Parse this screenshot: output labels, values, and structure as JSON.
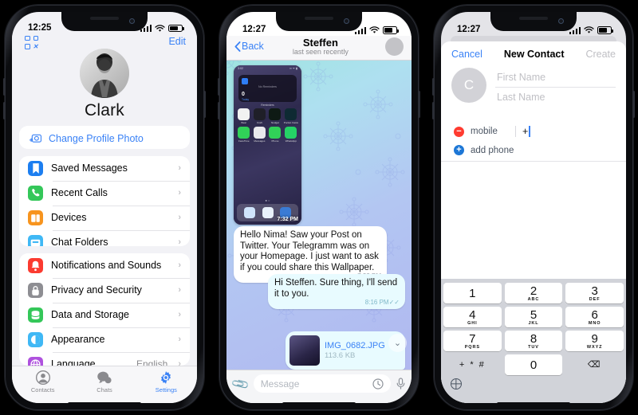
{
  "background_color": "#000000",
  "phone1": {
    "name": "telegram-settings-profile",
    "status_bar": {
      "time": "12:25",
      "icons": [
        "signal-icon",
        "wifi-icon",
        "battery-icon"
      ]
    },
    "header": {
      "qr_icon": "qr-code-icon",
      "edit_label": "Edit"
    },
    "profile": {
      "name": "Clark",
      "avatar": "user-photo"
    },
    "change_photo": {
      "label": "Change Profile Photo",
      "icon": "camera-plus-icon"
    },
    "group1": [
      {
        "label": "Saved Messages",
        "icon": "bookmark-icon",
        "color": "#1c7ef0"
      },
      {
        "label": "Recent Calls",
        "icon": "phone-icon",
        "color": "#34c759"
      },
      {
        "label": "Devices",
        "icon": "devices-icon",
        "color": "#f7941e"
      },
      {
        "label": "Chat Folders",
        "icon": "folder-icon",
        "color": "#3fb8f5"
      }
    ],
    "group2": [
      {
        "label": "Notifications and Sounds",
        "icon": "bell-icon",
        "color": "#fb3b30",
        "value": ""
      },
      {
        "label": "Privacy and Security",
        "icon": "lock-icon",
        "color": "#8e8e93",
        "value": ""
      },
      {
        "label": "Data and Storage",
        "icon": "data-icon",
        "color": "#34c759",
        "value": ""
      },
      {
        "label": "Appearance",
        "icon": "contrast-icon",
        "color": "#3fb8f5",
        "value": ""
      },
      {
        "label": "Language",
        "icon": "globe-icon",
        "color": "#af52de",
        "value": "English"
      }
    ],
    "tabs": [
      {
        "label": "Contacts",
        "icon": "contacts-icon",
        "active": false
      },
      {
        "label": "Chats",
        "icon": "chats-icon",
        "active": false
      },
      {
        "label": "Settings",
        "icon": "gear-icon",
        "active": true
      }
    ],
    "accent_color": "#3a82f6"
  },
  "phone2": {
    "name": "telegram-chat-steffen",
    "status_bar": {
      "time": "12:27"
    },
    "header": {
      "back_label": "Back",
      "title": "Steffen",
      "subtitle": "last seen recently"
    },
    "photo_message": {
      "timestamp": "7:32 PM",
      "screenshot": {
        "status_time": "3:02",
        "widget": {
          "title": "No Reminders",
          "count": "0",
          "day": "Today",
          "caption": "Reminders"
        },
        "apps_row1": [
          {
            "name": "Bear",
            "color": "#f2f2f2"
          },
          {
            "name": "Craft",
            "color": "#1f1f28"
          },
          {
            "name": "Nudget",
            "color": "#0e1a14"
          },
          {
            "name": "Pocket Casts",
            "color": "#0e2a33"
          }
        ],
        "apps_row2": [
          {
            "name": "FaceTime",
            "color": "#31d158"
          },
          {
            "name": "Messages",
            "color": "#e9e9ee"
          },
          {
            "name": "Phone",
            "color": "#31d158"
          },
          {
            "name": "WhatsApp",
            "color": "#25d366"
          }
        ],
        "page_dots": "● ○"
      }
    },
    "messages": [
      {
        "side": "in",
        "text": "Hello Nima! Saw your Post on Twitter. Your Telegramm was on your Homepage. I just want to ask if you could share this Wallpaper.",
        "time": "7:32 PM",
        "read": false
      },
      {
        "side": "out",
        "text": "Hi Steffen. Sure thing, I'll send it to you.",
        "time": "8:16 PM",
        "read": true
      }
    ],
    "file_message": {
      "filename": "IMG_0682.JPG",
      "filesize": "113.6 KB"
    },
    "scroll_button": "chevron-down-icon",
    "composer": {
      "attach_icon": "paperclip-icon",
      "placeholder": "Message",
      "timer_icon": "schedule-icon",
      "mic_icon": "microphone-icon"
    }
  },
  "phone3": {
    "name": "new-contact-sheet",
    "status_bar": {
      "time": "12:27"
    },
    "header": {
      "cancel": "Cancel",
      "title": "New Contact",
      "create": "Create"
    },
    "avatar_initial": "C",
    "fields": [
      {
        "name": "first-name",
        "placeholder": "First Name",
        "value": ""
      },
      {
        "name": "last-name",
        "placeholder": "Last Name",
        "value": ""
      }
    ],
    "phone_row": {
      "remove_icon": "minus-circle-icon",
      "label": "mobile",
      "value": "+"
    },
    "add_phone": {
      "icon": "plus-circle-icon",
      "label": "add phone"
    },
    "keypad": {
      "keys": [
        {
          "num": "1",
          "letters": ""
        },
        {
          "num": "2",
          "letters": "ABC"
        },
        {
          "num": "3",
          "letters": "DEF"
        },
        {
          "num": "4",
          "letters": "GHI"
        },
        {
          "num": "5",
          "letters": "JKL"
        },
        {
          "num": "6",
          "letters": "MNO"
        },
        {
          "num": "7",
          "letters": "PQRS"
        },
        {
          "num": "8",
          "letters": "TUV"
        },
        {
          "num": "9",
          "letters": "WXYZ"
        },
        {
          "num": "+ * #",
          "letters": "",
          "blank": true
        },
        {
          "num": "0",
          "letters": ""
        },
        {
          "num": "⌫",
          "letters": "",
          "blank": true
        }
      ],
      "globe_icon": "globe-icon"
    }
  }
}
